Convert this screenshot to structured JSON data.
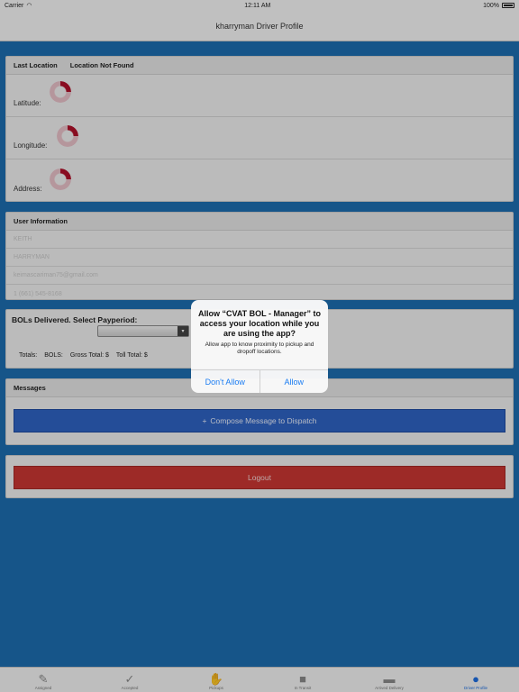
{
  "status_bar": {
    "carrier": "Carrier",
    "time": "12:11 AM",
    "battery": "100%"
  },
  "nav": {
    "title": "kharryman Driver Profile"
  },
  "location": {
    "header": "Last Location",
    "status": "Location Not Found",
    "fields": [
      {
        "label": "Latitude:"
      },
      {
        "label": "Longitude:"
      },
      {
        "label": "Address:"
      }
    ]
  },
  "user_info": {
    "header": "User Information",
    "fields": [
      "KEITH",
      "HARRYMAN",
      "keimascariman75@gmail.com",
      "1 (661) 545-8168"
    ]
  },
  "bols": {
    "title": "BOLs Delivered. Select Payperiod:",
    "select_value": "",
    "totals_label": "Totals:",
    "bols_label": "BOLS:",
    "gross_label": "Gross Total: $",
    "toll_label": "Toll Total: $"
  },
  "messages": {
    "header": "Messages",
    "compose_icon": "+",
    "compose_label": "Compose Message to Dispatch"
  },
  "logout": {
    "label": "Logout"
  },
  "alert": {
    "title": "Allow “CVAT BOL - Manager” to access your location while you are using the app?",
    "message": "Allow app to know proximity to pickup and dropoff locations.",
    "deny_label": "Don't Allow",
    "allow_label": "Allow"
  },
  "tabs": [
    {
      "label": "Assigned",
      "icon": "pencil-icon"
    },
    {
      "label": "Accepted",
      "icon": "check-circle-icon"
    },
    {
      "label": "Pickups",
      "icon": "handshake-icon"
    },
    {
      "label": "In Transit",
      "icon": "truck-icon"
    },
    {
      "label": "Arrived Delivery",
      "icon": "car-icon"
    },
    {
      "label": "Driver Profile",
      "icon": "person-icon",
      "active": true
    }
  ],
  "colors": {
    "background": "#1d6eb0",
    "compose": "#2f63c3",
    "logout": "#c93632",
    "spinner": "#b0102a",
    "alert_button": "#1a7cf2",
    "active_tab": "#1d6ee0"
  }
}
